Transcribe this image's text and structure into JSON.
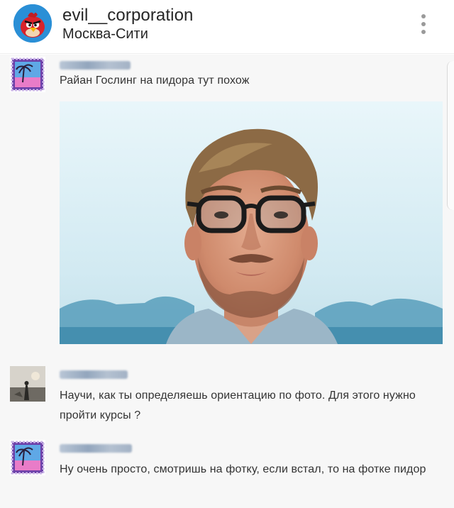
{
  "post": {
    "username": "evil__corporation",
    "location": "Москва-Сити"
  },
  "comments": [
    {
      "text": "Райан Гослинг на пидора тут похож"
    },
    {
      "text": "Научи, как ты определяешь ориентацию по фото. Для этого нужно пройти курсы ?"
    },
    {
      "text": "Ну очень просто, смотришь на фотку, если встал, то на фотке пидор"
    }
  ],
  "icons": {
    "avatar": "angry-bird-avatar",
    "more": "vertical-dots-icon"
  },
  "colors": {
    "avatar_bg": "#2a8fd6",
    "bird_red": "#d8232a",
    "text": "#262626"
  }
}
